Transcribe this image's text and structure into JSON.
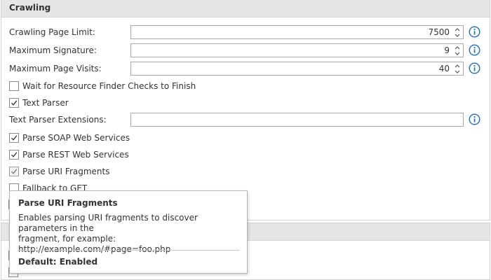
{
  "section": {
    "title": "Crawling"
  },
  "fields": [
    {
      "label": "Crawling Page Limit:",
      "value": "7500"
    },
    {
      "label": "Maximum Signature:",
      "value": "9"
    },
    {
      "label": "Maximum Page Visits:",
      "value": "40"
    }
  ],
  "checkboxes": [
    {
      "label": "Wait for Resource Finder Checks to Finish",
      "checked": false
    },
    {
      "label": "Text Parser",
      "checked": true
    }
  ],
  "text_parser_extensions": {
    "label": "Text Parser Extensions:",
    "value": ""
  },
  "checkboxes2": [
    {
      "label": "Parse SOAP Web Services",
      "checked": true
    },
    {
      "label": "Parse REST Web Services",
      "checked": true
    },
    {
      "label": "Parse URI Fragments",
      "checked": true,
      "disabled": true
    },
    {
      "label": "Fallback to GET",
      "checked": false
    }
  ],
  "tooltip": {
    "title": "Parse URI Fragments",
    "body_line1": "Enables parsing URI fragments to discover parameters in the",
    "body_line2": "fragment, for example:",
    "body_line3": "http://example.com/#page=foo.php",
    "default": "Default: Enabled"
  },
  "icons": {
    "info": "info-icon",
    "check": "checkmark-icon",
    "spinner": "spinner-arrows-icon"
  },
  "colors": {
    "info_blue": "#1f6fc0",
    "header_bg": "#e6e6e6"
  }
}
